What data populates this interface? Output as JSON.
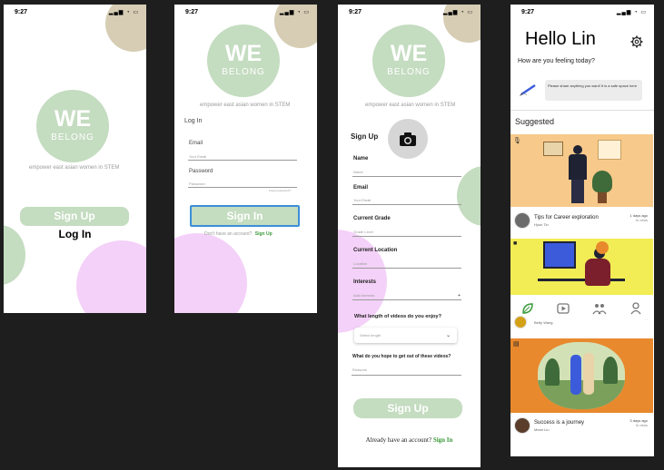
{
  "status_time": "9:27",
  "brand": {
    "we": "WE",
    "belong": "BELONG",
    "tagline": "empower east asian women in STEM"
  },
  "screen1": {
    "signup_label": "Sign Up",
    "login_label": "Log In"
  },
  "screen2": {
    "title": "Log In",
    "email_label": "Email",
    "email_placeholder": "Your Email",
    "password_label": "Password",
    "password_placeholder": "Password",
    "forgot": "Forgot password?",
    "signin_label": "Sign In",
    "no_account": "Don't have an account?",
    "signup_link": "Sign Up"
  },
  "screen3": {
    "title": "Sign Up",
    "name_label": "Name",
    "name_placeholder": "Name",
    "email_label": "Email",
    "email_placeholder": "Your Email",
    "grade_label": "Current Grade",
    "grade_placeholder": "Grade Level",
    "location_label": "Current Location",
    "location_placeholder": "Location",
    "interests_label": "Interests",
    "interests_placeholder": "Add interests",
    "video_q": "What length of videos do you enjoy?",
    "select_placeholder": "Select length",
    "hope_q": "What do you hope to get out of these videos?",
    "reasons_placeholder": "Reasons",
    "signup_label": "Sign Up",
    "have_account": "Already have an account?",
    "signin_link": "Sign In"
  },
  "screen4": {
    "greeting": "Hello Lin",
    "question": "How are you feeling today?",
    "prompt_text": "Please share anything you want! It is a safe space here",
    "suggested": "Suggested",
    "cards": [
      {
        "title": "Tips for Career exploration",
        "author": "Hyun Tin",
        "time": "1 days ago",
        "views": "1k views"
      },
      {
        "title": "",
        "author": "Betty Wang",
        "time": "",
        "views": ""
      },
      {
        "title": "Success is a journey",
        "author": "Mean Liu",
        "time": "3 days ago",
        "views": "1k views"
      }
    ]
  },
  "colors": {
    "sage": "#c4dcc0",
    "tan": "#d6cdb4",
    "pink": "#f4d1f8",
    "link": "#3b9a3b",
    "orange_card": "#f7c98a",
    "yellow_card": "#f2ec55",
    "amber_card": "#e8892d"
  }
}
